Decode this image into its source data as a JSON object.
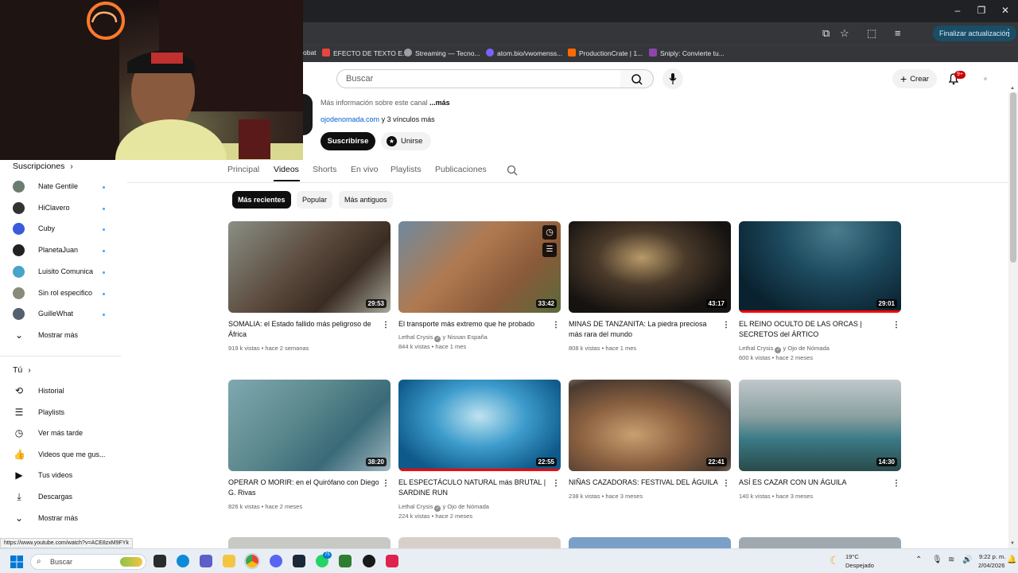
{
  "browser": {
    "update_label": "Finalizar actualización",
    "bookmarks": [
      {
        "label": "obat",
        "color": "#d93025"
      },
      {
        "label": "EFECTO DE TEXTO E...",
        "color": "#e8453c"
      },
      {
        "label": "Streaming — Tecno...",
        "color": "#9aa0a6"
      },
      {
        "label": "atom.bio/vwomenss...",
        "color": "#7b61ff"
      },
      {
        "label": "ProductionCrate | 1...",
        "color": "#ff6a00"
      },
      {
        "label": "Sniply: Convierte tu...",
        "color": "#8e44ad"
      }
    ],
    "status_url": "https://www.youtube.com/watch?v=ACE8zxM9FYk"
  },
  "header": {
    "search_placeholder": "Buscar",
    "create_label": "Crear",
    "notif_count": "9+"
  },
  "channel": {
    "more_info": "Más información sobre este canal",
    "more_link": "...más",
    "website": "ojodenomada.com",
    "links_suffix": " y 3 vínculos más",
    "subscribe_label": "Suscribirse",
    "join_label": "Unirse"
  },
  "tabs": [
    {
      "label": "Principal"
    },
    {
      "label": "Videos"
    },
    {
      "label": "Shorts"
    },
    {
      "label": "En vivo"
    },
    {
      "label": "Playlists"
    },
    {
      "label": "Publicaciones"
    }
  ],
  "chips": [
    {
      "label": "Más recientes"
    },
    {
      "label": "Popular"
    },
    {
      "label": "Más antiguos"
    }
  ],
  "sidebar": {
    "subs_heading": "Suscripciones",
    "subscriptions": [
      {
        "label": "Nate Gentile",
        "color": "#6b7d6e"
      },
      {
        "label": "HiClavero",
        "color": "#333"
      },
      {
        "label": "Cuby",
        "color": "#3b5bdb"
      },
      {
        "label": "PlanetaJuan",
        "color": "#222"
      },
      {
        "label": "Luisito Comunica",
        "color": "#4aa3c8"
      },
      {
        "label": "Sin rol especifico",
        "color": "#8a8a7a"
      },
      {
        "label": "GuilleWhat",
        "color": "#556070"
      }
    ],
    "show_more": "Mostrar más",
    "you_heading": "Tú",
    "you_items": [
      {
        "label": "Historial",
        "icon": "history-icon",
        "glyph": "⟲"
      },
      {
        "label": "Playlists",
        "icon": "playlist-icon",
        "glyph": "☰"
      },
      {
        "label": "Ver más tarde",
        "icon": "clock-icon",
        "glyph": "◷"
      },
      {
        "label": "Videos que me gus...",
        "icon": "thumbs-up-icon",
        "glyph": "👍"
      },
      {
        "label": "Tus videos",
        "icon": "my-videos-icon",
        "glyph": "▶"
      },
      {
        "label": "Descargas",
        "icon": "download-icon",
        "glyph": "⤓"
      }
    ],
    "show_more_2": "Mostrar más"
  },
  "videos": [
    {
      "title": "SOMALIA: el Estado fallido más peligroso de África",
      "duration": "29:53",
      "channel": "",
      "meta": "919 k vistas • hace 2 semanas",
      "bg": "linear-gradient(135deg,#8a8f85 0%,#5b4a3d 45%,#3a2c22 70%,#a8a89a 100%)",
      "progress": 0
    },
    {
      "title": "El transporte más extremo que he probado",
      "duration": "33:42",
      "channel": "Lethal Crysis",
      "collab": "y Nissan España",
      "meta": "844 k vistas • hace 1 mes",
      "bg": "linear-gradient(135deg,#6e8aa0 0%,#b07a50 40%,#8a5a3a 70%,#5a6a3a 100%)",
      "progress": 0
    },
    {
      "title": "MINAS DE TANZANITA: La piedra preciosa más rara del mundo",
      "duration": "43:17",
      "channel": "",
      "meta": "808 k vistas • hace 1 mes",
      "bg": "radial-gradient(ellipse at 45% 40%,#b89a6a 0%,#4a3a2a 35%,#151210 75%)",
      "progress": 0
    },
    {
      "title": "EL REINO OCULTO DE LAS ORCAS | SECRETOS del ÁRTICO",
      "duration": "29:01",
      "channel": "Lethal Crysis",
      "collab": "y Ojo de Nómada",
      "meta": "600 k vistas • hace 2 meses",
      "bg": "radial-gradient(ellipse at 60% 10%,#4a7c8e 0%,#1d4a5e 40%,#0a2230 80%)",
      "progress": 100
    },
    {
      "title": "OPERAR O MORIR: en el Quirófano con Diego G. Rivas",
      "duration": "38:20",
      "channel": "",
      "meta": "826 k vistas • hace 2 meses",
      "bg": "linear-gradient(135deg,#7fa8b0 0%,#5d8a8e 40%,#3a6a78 70%,#a0b8c0 100%)",
      "progress": 0
    },
    {
      "title": "EL ESPECTÁCULO NATURAL más BRUTAL | SARDINE RUN",
      "duration": "22:55",
      "channel": "Lethal Crysis",
      "collab": "y Ojo de Nómada",
      "meta": "224 k vistas • hace 2 meses",
      "bg": "radial-gradient(ellipse at 50% 40%,#bfe3f0 0%,#3d9ccc 40%,#0e5a8a 80%)",
      "progress": 100
    },
    {
      "title": "NIÑAS CAZADORAS: FESTIVAL DEL ÁGUILA",
      "duration": "22:41",
      "channel": "",
      "meta": "238 k vistas • hace 3 meses",
      "bg": "radial-gradient(ellipse at 40% 60%,#c8a070 0%,#8a6040 40%,#4a3a30 75%,#a8a8a0 100%)",
      "progress": 0
    },
    {
      "title": "ASÍ ES CAZAR CON UN ÁGUILA",
      "duration": "14:30",
      "channel": "",
      "meta": "140 k vistas • hace 3 meses",
      "bg": "linear-gradient(180deg,#c0c8cc 0%,#8aa0a0 40%,#3a7a86 65%,#2a4a4a 100%)",
      "progress": 0
    }
  ],
  "taskbar": {
    "search_label": "Buscar",
    "weather_temp": "19°C",
    "weather_desc": "Despejado",
    "time": "9:22 p. m.",
    "date": "2/04/2026",
    "badge_count": "75"
  }
}
